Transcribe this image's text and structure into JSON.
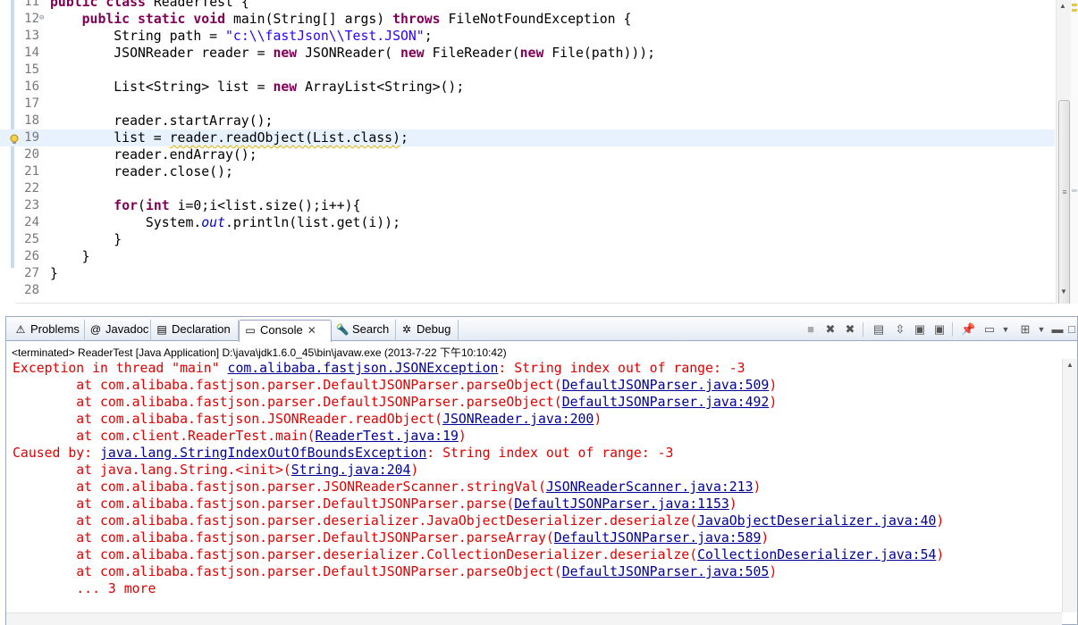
{
  "editor": {
    "lines": [
      {
        "num": "11",
        "html": "<span class=\"kw\">public</span> <span class=\"kw\">class</span> ReaderTest {"
      },
      {
        "num": "12",
        "fold": true,
        "html": "    <span class=\"kw\">public</span> <span class=\"kw\">static</span> <span class=\"kw\">void</span> main(String[] args) <span class=\"kw\">throws</span> FileNotFoundException {"
      },
      {
        "num": "13",
        "html": "        String path = <span class=\"str\">\"c:\\\\fastJson\\\\Test.JSON\"</span>;"
      },
      {
        "num": "14",
        "html": "        JSONReader reader = <span class=\"kw\">new</span> JSONReader( <span class=\"kw\">new</span> FileReader(<span class=\"kw\">new</span> File(path)));"
      },
      {
        "num": "15",
        "html": ""
      },
      {
        "num": "16",
        "html": "        List&lt;String&gt; list = <span class=\"kw\">new</span> ArrayList&lt;String&gt;();"
      },
      {
        "num": "17",
        "html": ""
      },
      {
        "num": "18",
        "html": "        reader.startArray();"
      },
      {
        "num": "19",
        "warn": true,
        "current": true,
        "html": "        list = <span class=\"squig\">reader.readObject(List.class)</span>;"
      },
      {
        "num": "20",
        "html": "        reader.endArray();"
      },
      {
        "num": "21",
        "html": "        reader.close();"
      },
      {
        "num": "22",
        "html": ""
      },
      {
        "num": "23",
        "html": "        <span class=\"kw\">for</span>(<span class=\"kw\">int</span> i=0;i&lt;list.size();i++){"
      },
      {
        "num": "24",
        "html": "            System.<span class=\"fld\">out</span>.println(list.get(i));"
      },
      {
        "num": "25",
        "html": "        }"
      },
      {
        "num": "26",
        "html": "    }"
      },
      {
        "num": "27",
        "html": "}"
      },
      {
        "num": "28",
        "html": ""
      }
    ]
  },
  "panel": {
    "tabs": [
      {
        "id": "problems",
        "label": "Problems",
        "icon": "problems-icon",
        "glyph": "⚠"
      },
      {
        "id": "javadoc",
        "label": "Javadoc",
        "icon": "javadoc-icon",
        "glyph": "@"
      },
      {
        "id": "declaration",
        "label": "Declaration",
        "icon": "declaration-icon",
        "glyph": "▤"
      },
      {
        "id": "console",
        "label": "Console",
        "icon": "console-icon",
        "glyph": "▭",
        "active": true
      },
      {
        "id": "search",
        "label": "Search",
        "icon": "search-icon",
        "glyph": "🔦"
      },
      {
        "id": "debug",
        "label": "Debug",
        "icon": "debug-icon",
        "glyph": "✲"
      }
    ],
    "status": "<terminated> ReaderTest [Java Application] D:\\java\\jdk1.6.0_45\\bin\\javaw.exe (2013-7-22 下午10:10:42)",
    "console_lines": [
      [
        "Exception in thread \"main\" ",
        {
          "link": "com.alibaba.fastjson.JSONException"
        },
        ": String index out of range: -3"
      ],
      [
        "\tat com.alibaba.fastjson.parser.DefaultJSONParser.parseObject(",
        {
          "link": "DefaultJSONParser.java:509"
        },
        ")"
      ],
      [
        "\tat com.alibaba.fastjson.parser.DefaultJSONParser.parseObject(",
        {
          "link": "DefaultJSONParser.java:492"
        },
        ")"
      ],
      [
        "\tat com.alibaba.fastjson.JSONReader.readObject(",
        {
          "link": "JSONReader.java:200"
        },
        ")"
      ],
      [
        "\tat com.client.ReaderTest.main(",
        {
          "link": "ReaderTest.java:19"
        },
        ")"
      ],
      [
        "Caused by: ",
        {
          "link": "java.lang.StringIndexOutOfBoundsException"
        },
        ": String index out of range: -3"
      ],
      [
        "\tat java.lang.String.<init>(",
        {
          "link": "String.java:204"
        },
        ")"
      ],
      [
        "\tat com.alibaba.fastjson.parser.JSONReaderScanner.stringVal(",
        {
          "link": "JSONReaderScanner.java:213"
        },
        ")"
      ],
      [
        "\tat com.alibaba.fastjson.parser.DefaultJSONParser.parse(",
        {
          "link": "DefaultJSONParser.java:1153"
        },
        ")"
      ],
      [
        "\tat com.alibaba.fastjson.parser.deserializer.JavaObjectDeserializer.deserialze(",
        {
          "link": "JavaObjectDeserializer.java:40"
        },
        ")"
      ],
      [
        "\tat com.alibaba.fastjson.parser.DefaultJSONParser.parseArray(",
        {
          "link": "DefaultJSONParser.java:589"
        },
        ")"
      ],
      [
        "\tat com.alibaba.fastjson.parser.deserializer.CollectionDeserializer.deserialze(",
        {
          "link": "CollectionDeserializer.java:54"
        },
        ")"
      ],
      [
        "\tat com.alibaba.fastjson.parser.DefaultJSONParser.parseObject(",
        {
          "link": "DefaultJSONParser.java:505"
        },
        ")"
      ],
      [
        "\t... 3 more"
      ]
    ]
  },
  "colors": {
    "keyword": "#7f0055",
    "string": "#2a00ff",
    "console_error": "#e10000",
    "console_link": "#000095"
  }
}
